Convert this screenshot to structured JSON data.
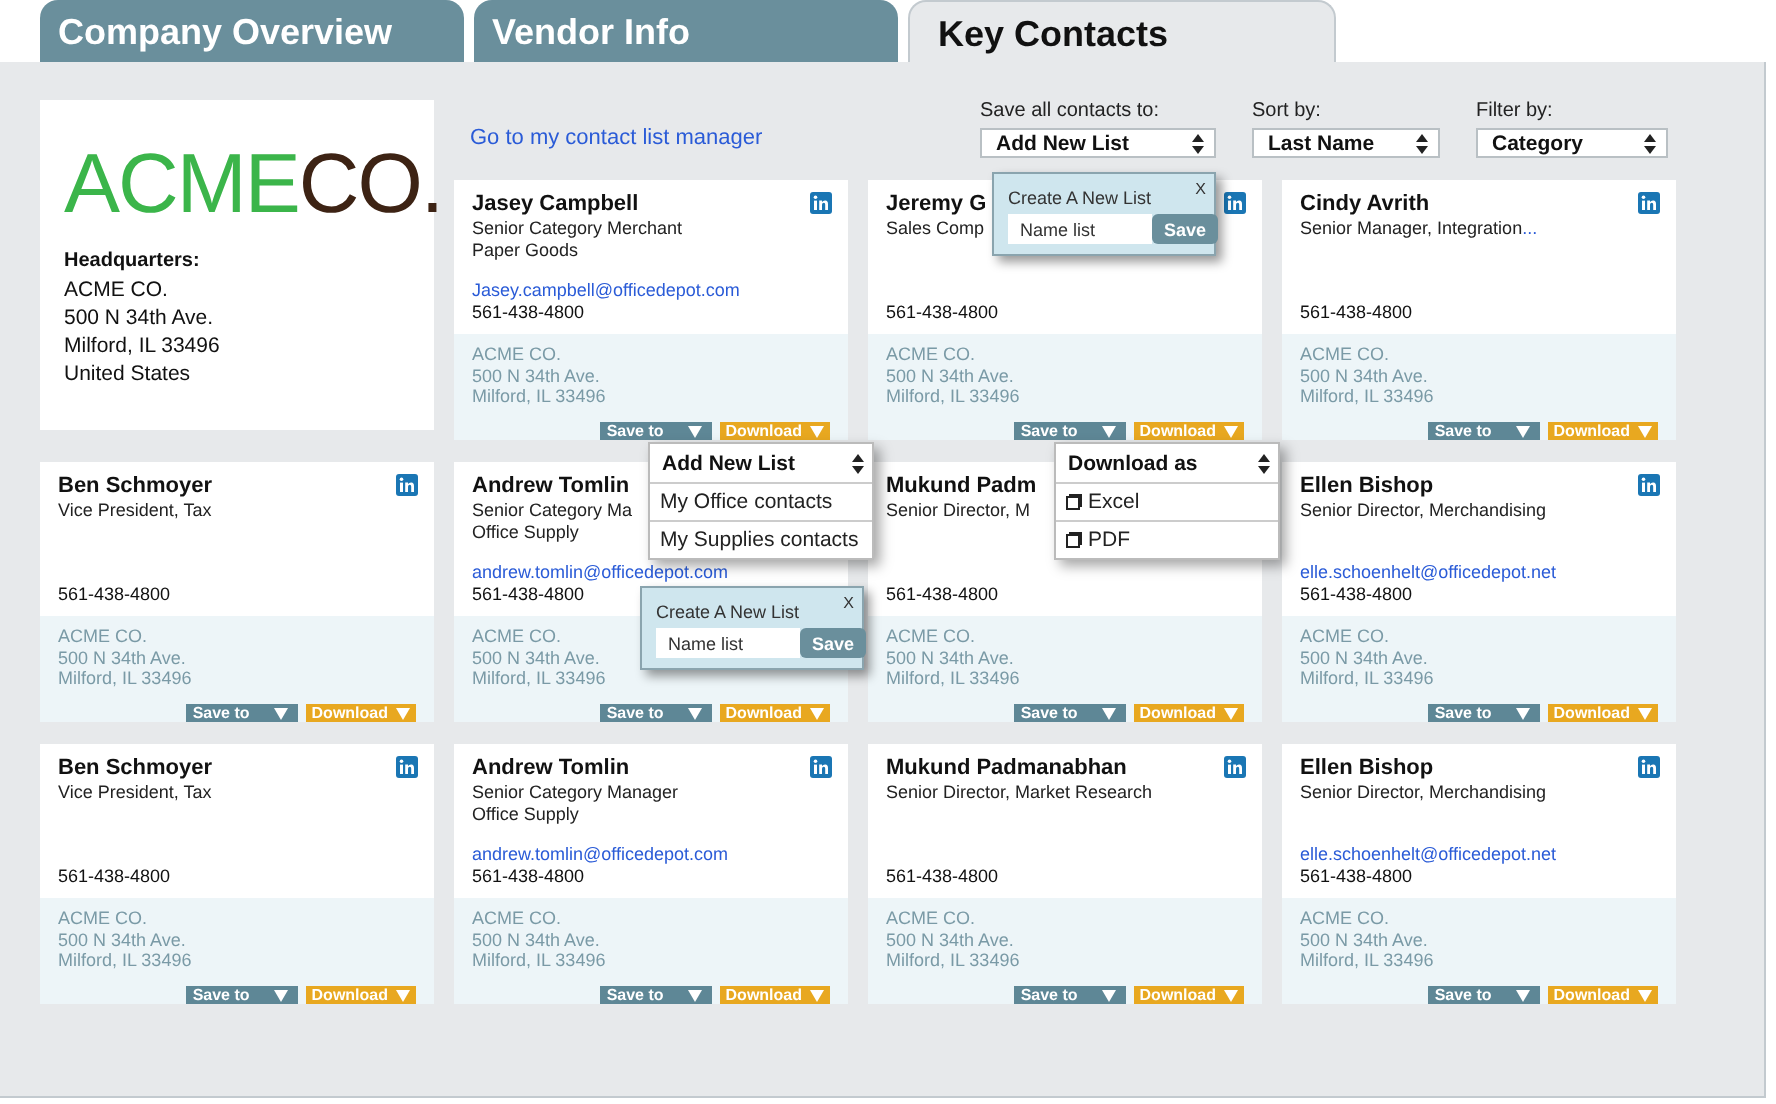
{
  "tabs": [
    {
      "label": "Company Overview",
      "selected": false
    },
    {
      "label": "Vendor Info",
      "selected": false
    },
    {
      "label": "Key Contacts",
      "selected": true
    }
  ],
  "company": {
    "logo": [
      "ACME",
      "CO."
    ],
    "heading": "Headquarters:",
    "lines": [
      "ACME CO.",
      "500 N 34th Ave.",
      "Milford, IL 33496",
      "United States"
    ]
  },
  "manager_link": "Go to my contact list manager",
  "controls": [
    {
      "label": "Save all contacts to:",
      "value": "Add New List"
    },
    {
      "label": "Sort by:",
      "value": "Last Name"
    },
    {
      "label": "Filter by:",
      "value": "Category"
    }
  ],
  "cards": [
    {
      "name": "Jasey Campbell",
      "title": [
        "Senior Category Merchant",
        "Paper Goods"
      ],
      "email": "Jasey.campbell@officedepot.com",
      "phone": "561-438-4800",
      "address": [
        "ACME CO.",
        "500 N 34th Ave.",
        "Milford, IL 33496"
      ],
      "linkedin": true,
      "save": "Save to",
      "download": "Download"
    },
    {
      "name": "Jeremy G",
      "title": [
        "Sales Comp"
      ],
      "phone": "561-438-4800",
      "address": [
        "ACME CO.",
        "500 N 34th Ave.",
        "Milford, IL 33496"
      ],
      "linkedin": true,
      "save": "Save to",
      "download": "Download"
    },
    {
      "name": "Cindy Avrith",
      "title": [
        "Senior Manager, Integration"
      ],
      "more": "...",
      "phone": "561-438-4800",
      "address": [
        "ACME CO.",
        "500 N 34th Ave.",
        "Milford, IL 33496"
      ],
      "linkedin": true,
      "save": "Save to",
      "download": "Download"
    },
    {
      "name": "Ben Schmoyer",
      "title": [
        "Vice President, Tax"
      ],
      "phone": "561-438-4800",
      "address": [
        "ACME CO.",
        "500 N 34th Ave.",
        "Milford, IL 33496"
      ],
      "linkedin": true,
      "save": "Save to",
      "download": "Download"
    },
    {
      "name": "Andrew Tomlin",
      "title": [
        "Senior Category Ma",
        "Office Supply"
      ],
      "email": "andrew.tomlin@officedepot.com",
      "phone": "561-438-4800",
      "address": [
        "ACME CO.",
        "500 N 34th Ave.",
        "Milford, IL 33496"
      ],
      "linkedin": false,
      "save": "Save to",
      "download": "Download"
    },
    {
      "name": "Mukund Padm",
      "title": [
        "Senior Director, M"
      ],
      "phone": "561-438-4800",
      "address": [
        "ACME CO.",
        "500 N 34th Ave.",
        "Milford, IL 33496"
      ],
      "linkedin": false,
      "save": "Save to",
      "download": "Download"
    },
    {
      "name": "Ellen Bishop",
      "title": [
        "Senior Director, Merchandising"
      ],
      "email": "elle.schoenhelt@officedepot.net",
      "phone": "561-438-4800",
      "address": [
        "ACME CO.",
        "500 N 34th Ave.",
        "Milford, IL 33496"
      ],
      "linkedin": true,
      "save": "Save to",
      "download": "Download"
    },
    {
      "name": "Ben Schmoyer",
      "title": [
        "Vice President, Tax"
      ],
      "phone": "561-438-4800",
      "address": [
        "ACME CO.",
        "500 N 34th Ave.",
        "Milford, IL 33496"
      ],
      "linkedin": true,
      "save": "Save to",
      "download": "Download"
    },
    {
      "name": "Andrew Tomlin",
      "title": [
        "Senior Category Manager",
        "Office Supply"
      ],
      "email": "andrew.tomlin@officedepot.com",
      "phone": "561-438-4800",
      "address": [
        "ACME CO.",
        "500 N 34th Ave.",
        "Milford, IL 33496"
      ],
      "linkedin": true,
      "save": "Save to",
      "download": "Download"
    },
    {
      "name": "Mukund Padmanabhan",
      "title": [
        "Senior Director, Market Research"
      ],
      "phone": "561-438-4800",
      "address": [
        "ACME CO.",
        "500 N 34th Ave.",
        "Milford, IL 33496"
      ],
      "linkedin": true,
      "save": "Save to",
      "download": "Download"
    },
    {
      "name": "Ellen Bishop",
      "title": [
        "Senior Director, Merchandising"
      ],
      "email": "elle.schoenhelt@officedepot.net",
      "phone": "561-438-4800",
      "address": [
        "ACME CO.",
        "500 N 34th Ave.",
        "Milford, IL 33496"
      ],
      "linkedin": true,
      "save": "Save to",
      "download": "Download"
    }
  ],
  "overlays": [
    {
      "kind": "new_list_popup",
      "title": "Create A New List",
      "close": "X",
      "placeholder": "Name list",
      "button": "Save"
    },
    {
      "kind": "menu",
      "header": "Add New List",
      "items": [
        {
          "label": "My Office contacts"
        },
        {
          "label": "My Supplies contacts"
        }
      ]
    },
    {
      "kind": "menu",
      "header": "Download as",
      "items": [
        {
          "label": "Excel",
          "checked": false
        },
        {
          "label": "PDF",
          "checked": false
        }
      ]
    },
    {
      "kind": "new_list_popup",
      "title": "Create A New List",
      "close": "X",
      "placeholder": "Name list",
      "button": "Save"
    }
  ]
}
